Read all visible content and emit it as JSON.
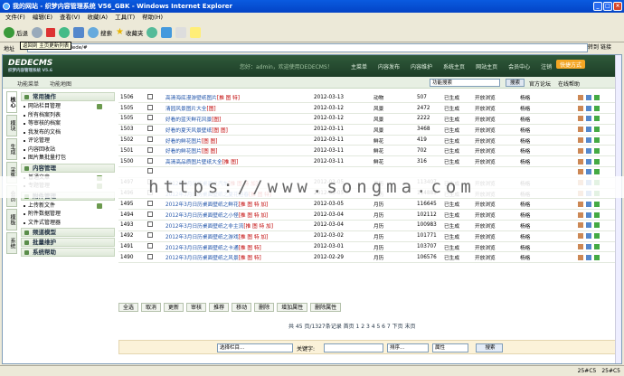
{
  "window": {
    "title": "我的网站 - 织梦内容管理系统 V56_GBK - Windows Internet Explorer"
  },
  "menu": [
    "文件(F)",
    "编辑(E)",
    "查看(V)",
    "收藏(A)",
    "工具(T)",
    "帮助(H)"
  ],
  "toolbar": {
    "back": "后退",
    "search": "搜索",
    "favorites": "收藏夹"
  },
  "tooltip": "返回到 主页更新列表",
  "address": {
    "label": "地址",
    "url": "http://localhost/dede/#",
    "go": "转到",
    "links": "链接"
  },
  "header": {
    "logo": "DEDECMS",
    "logo_sub": "织梦内容管理系统 V5.6",
    "welcome": "您好：admin，欢迎使用DEDECMS！",
    "nav": [
      "主菜单",
      "内容发布",
      "内容维护",
      "系统主页",
      "网站主页",
      "会员中心",
      "注销"
    ],
    "quick": "快捷方式"
  },
  "subbar": {
    "menu": "功能菜单",
    "left": "功能地图",
    "select_value": "功能搜索",
    "search": "搜索",
    "links": [
      "官方论坛",
      "在线帮助"
    ]
  },
  "vtabs": [
    "核心",
    "模块",
    "生成",
    "采集",
    "会员",
    "模板",
    "系统"
  ],
  "sidebar": [
    {
      "title": "常用操作",
      "items": [
        "网站栏目管理",
        "所有档案列表",
        "等审核的档案",
        "我发布的文档",
        "评论管理",
        "内容回收站",
        "图片集批量打包"
      ]
    },
    {
      "title": "内容管理",
      "items": [
        "普通文章",
        "专题管理"
      ]
    },
    {
      "title": "附件管理",
      "items": [
        "上传新文件",
        "附件数据管理",
        "文件式管理器"
      ]
    },
    {
      "title": "频道模型",
      "items": []
    },
    {
      "title": "批量维护",
      "items": []
    },
    {
      "title": "系统帮助",
      "items": []
    }
  ],
  "table": {
    "rows": [
      {
        "id": "1506",
        "title": "高清海底漫游壁纸图片",
        "tags": "[推 图 特]",
        "date": "2012-03-13",
        "cat": "动物",
        "hits": "507",
        "status": "已生成",
        "perm": "开放浏览",
        "user": "杨格"
      },
      {
        "id": "1505",
        "title": "清园风景图片大全",
        "tags": "[图]",
        "date": "2012-03-12",
        "cat": "风景",
        "hits": "2472",
        "status": "已生成",
        "perm": "开放浏览",
        "user": "杨格"
      },
      {
        "id": "1505",
        "title": "好看的蓝天鲜花风景",
        "tags": "[图]",
        "date": "2012-03-12",
        "cat": "风景",
        "hits": "2222",
        "status": "已生成",
        "perm": "开放浏览",
        "user": "杨格"
      },
      {
        "id": "1503",
        "title": "好看的夏天风景壁纸",
        "tags": "[图 图]",
        "date": "2012-03-11",
        "cat": "风景",
        "hits": "3468",
        "status": "已生成",
        "perm": "开放浏览",
        "user": "杨格"
      },
      {
        "id": "1502",
        "title": "好看的鲜花图片",
        "tags": "[图 图]",
        "date": "2012-03-11",
        "cat": "鲜花",
        "hits": "419",
        "status": "已生成",
        "perm": "开放浏览",
        "user": "杨格"
      },
      {
        "id": "1501",
        "title": "好看的鲜花图片",
        "tags": "[图 图]",
        "date": "2012-03-11",
        "cat": "鲜花",
        "hits": "702",
        "status": "已生成",
        "perm": "开放浏览",
        "user": "杨格"
      },
      {
        "id": "1500",
        "title": "高清高品质图片壁纸大全",
        "tags": "[推 图]",
        "date": "2012-03-11",
        "cat": "鲜花",
        "hits": "316",
        "status": "已生成",
        "perm": "开放浏览",
        "user": "杨格"
      },
      {
        "id": "",
        "title": "",
        "tags": "",
        "date": "",
        "cat": "",
        "hits": "",
        "status": "",
        "perm": "",
        "user": ""
      },
      {
        "id": "1497",
        "title": "2012年3月日历桌面之汽车",
        "tags": "[推 图 特 加]",
        "date": "2012-03-05",
        "cat": "月历",
        "hits": "113407",
        "status": "已生成",
        "perm": "开放浏览",
        "user": "杨格"
      },
      {
        "id": "1496",
        "title": "2012年3月日历桌面壁纸之夏花迎春",
        "tags": "[推 图 特]",
        "date": "2012-03-05",
        "cat": "月历",
        "hits": "114885",
        "status": "已生成",
        "perm": "开放浏览",
        "user": "杨格"
      },
      {
        "id": "1495",
        "title": "2012年3月日历桌面壁纸之鲜花",
        "tags": "[推 图 特 加]",
        "date": "2012-03-05",
        "cat": "月历",
        "hits": "116645",
        "status": "已生成",
        "perm": "开放浏览",
        "user": "杨格"
      },
      {
        "id": "1494",
        "title": "2012年3月日历桌面壁纸之小怪",
        "tags": "[推 图 特 加]",
        "date": "2012-03-04",
        "cat": "月历",
        "hits": "102112",
        "status": "已生成",
        "perm": "开放浏览",
        "user": "杨格"
      },
      {
        "id": "1493",
        "title": "2012年3月日历桌面壁纸之非主流",
        "tags": "[推 图 特 加]",
        "date": "2012-03-04",
        "cat": "月历",
        "hits": "100983",
        "status": "已生成",
        "perm": "开放浏览",
        "user": "杨格"
      },
      {
        "id": "1492",
        "title": "2012年3月日历桌面壁纸之游戏",
        "tags": "[推 图 特 加]",
        "date": "2012-03-02",
        "cat": "月历",
        "hits": "101771",
        "status": "已生成",
        "perm": "开放浏览",
        "user": "杨格"
      },
      {
        "id": "1491",
        "title": "2012年3月日历桌面壁纸之卡通",
        "tags": "[推 图 特]",
        "date": "2012-03-01",
        "cat": "月历",
        "hits": "103707",
        "status": "已生成",
        "perm": "开放浏览",
        "user": "杨格"
      },
      {
        "id": "1490",
        "title": "2012年3月日历桌面壁纸之风景",
        "tags": "[推 图 特]",
        "date": "2012-02-29",
        "cat": "月历",
        "hits": "106576",
        "status": "已生成",
        "perm": "开放浏览",
        "user": "杨格"
      }
    ]
  },
  "buttons": [
    "全选",
    "取消",
    "更新",
    "审核",
    "推荐",
    "移动",
    "删除",
    "增加属性",
    "删除属性"
  ],
  "pager": "共 45 页/1327条记录 首页 1 2 3 4 5 6 7 下页 末页",
  "search": {
    "select_cat": "选择栏目...",
    "keyword_label": "关键字:",
    "keyword_value": "",
    "sort": "排序...",
    "attr": "属性",
    "button": "搜索"
  },
  "status": {
    "left": "",
    "zone": "25#C5",
    "zone2": "25#C5"
  },
  "watermark": "https://www.songma.com"
}
